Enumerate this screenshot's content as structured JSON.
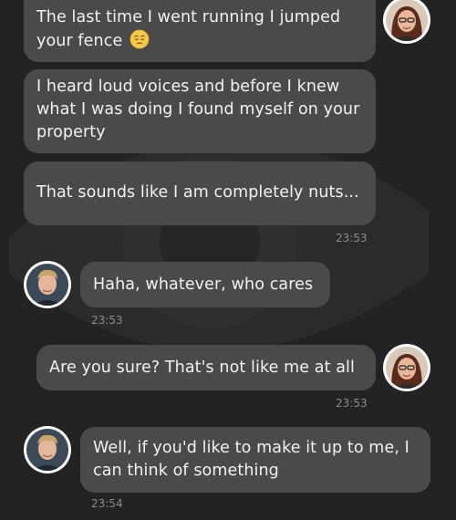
{
  "background_color": "#232323",
  "bubble_color": "#4a4a4a",
  "messages": [
    {
      "sender": "me",
      "text": "The last time I went running I jumped your fence",
      "emoji": "pensive-face-emoji"
    },
    {
      "sender": "me",
      "text": "I heard loud voices and before I knew what I was doing I found myself on your property"
    },
    {
      "sender": "me",
      "text": "That sounds like I am completely nuts..."
    },
    {
      "sender": "them",
      "text": "Haha, whatever, who cares"
    },
    {
      "sender": "me",
      "text": "Are you sure? That's not like me at all"
    },
    {
      "sender": "them",
      "text": "Well, if you'd like to make it up to me, I can think of something"
    }
  ],
  "timestamps": {
    "t1": "23:53",
    "t2": "23:53",
    "t3": "23:53",
    "t4": "23:54"
  }
}
